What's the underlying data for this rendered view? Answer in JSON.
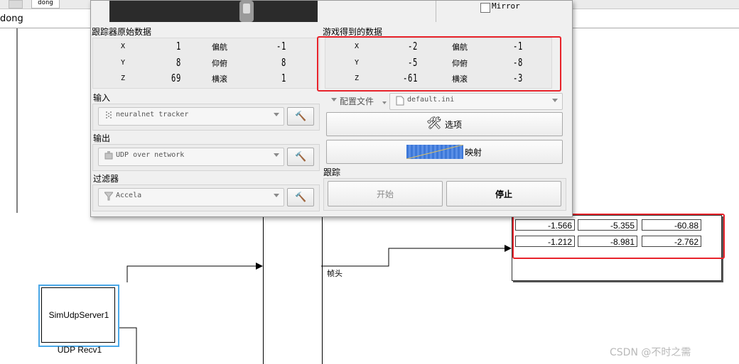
{
  "window": {
    "tab_label": "dong",
    "address_text": "dong"
  },
  "tracker_dialog": {
    "mirror_label": "Mirror",
    "raw_data_title": "跟踪器原始数据",
    "game_data_title": "游戏得到的数据",
    "raw_pose": [
      {
        "axis": "X",
        "value": "1",
        "rot_label": "偏航",
        "rot_value": "-1"
      },
      {
        "axis": "Y",
        "value": "8",
        "rot_label": "仰俯",
        "rot_value": "8"
      },
      {
        "axis": "Z",
        "value": "69",
        "rot_label": "横滚",
        "rot_value": "1"
      }
    ],
    "game_pose": [
      {
        "axis": "X",
        "value": "-2",
        "rot_label": "偏航",
        "rot_value": "-1"
      },
      {
        "axis": "Y",
        "value": "-5",
        "rot_label": "仰俯",
        "rot_value": "-8"
      },
      {
        "axis": "Z",
        "value": "-61",
        "rot_label": "横滚",
        "rot_value": "-3"
      }
    ],
    "input_title": "输入",
    "input_value": "neuralnet tracker",
    "output_title": "输出",
    "output_value": "UDP over network",
    "filter_title": "过滤器",
    "filter_value": "Accela",
    "profile_label": "配置文件",
    "profile_value": "default.ini",
    "options_label": "选项",
    "mapping_label": "映射",
    "tracking_title": "跟踪",
    "start_label": "开始",
    "stop_label": "停止"
  },
  "display": {
    "rows": [
      [
        "-1.566",
        "-5.355",
        "-60.88"
      ],
      [
        "-1.212",
        "-8.981",
        "-2.762"
      ]
    ]
  },
  "blocks": {
    "udp_name": "SimUdpServer1",
    "udp_label": "UDP Recv1",
    "frame_label": "帧头"
  },
  "watermark": "CSDN @不时之需",
  "colors": {
    "highlight": "#e8232b",
    "block_border": "#4aa8e8"
  }
}
